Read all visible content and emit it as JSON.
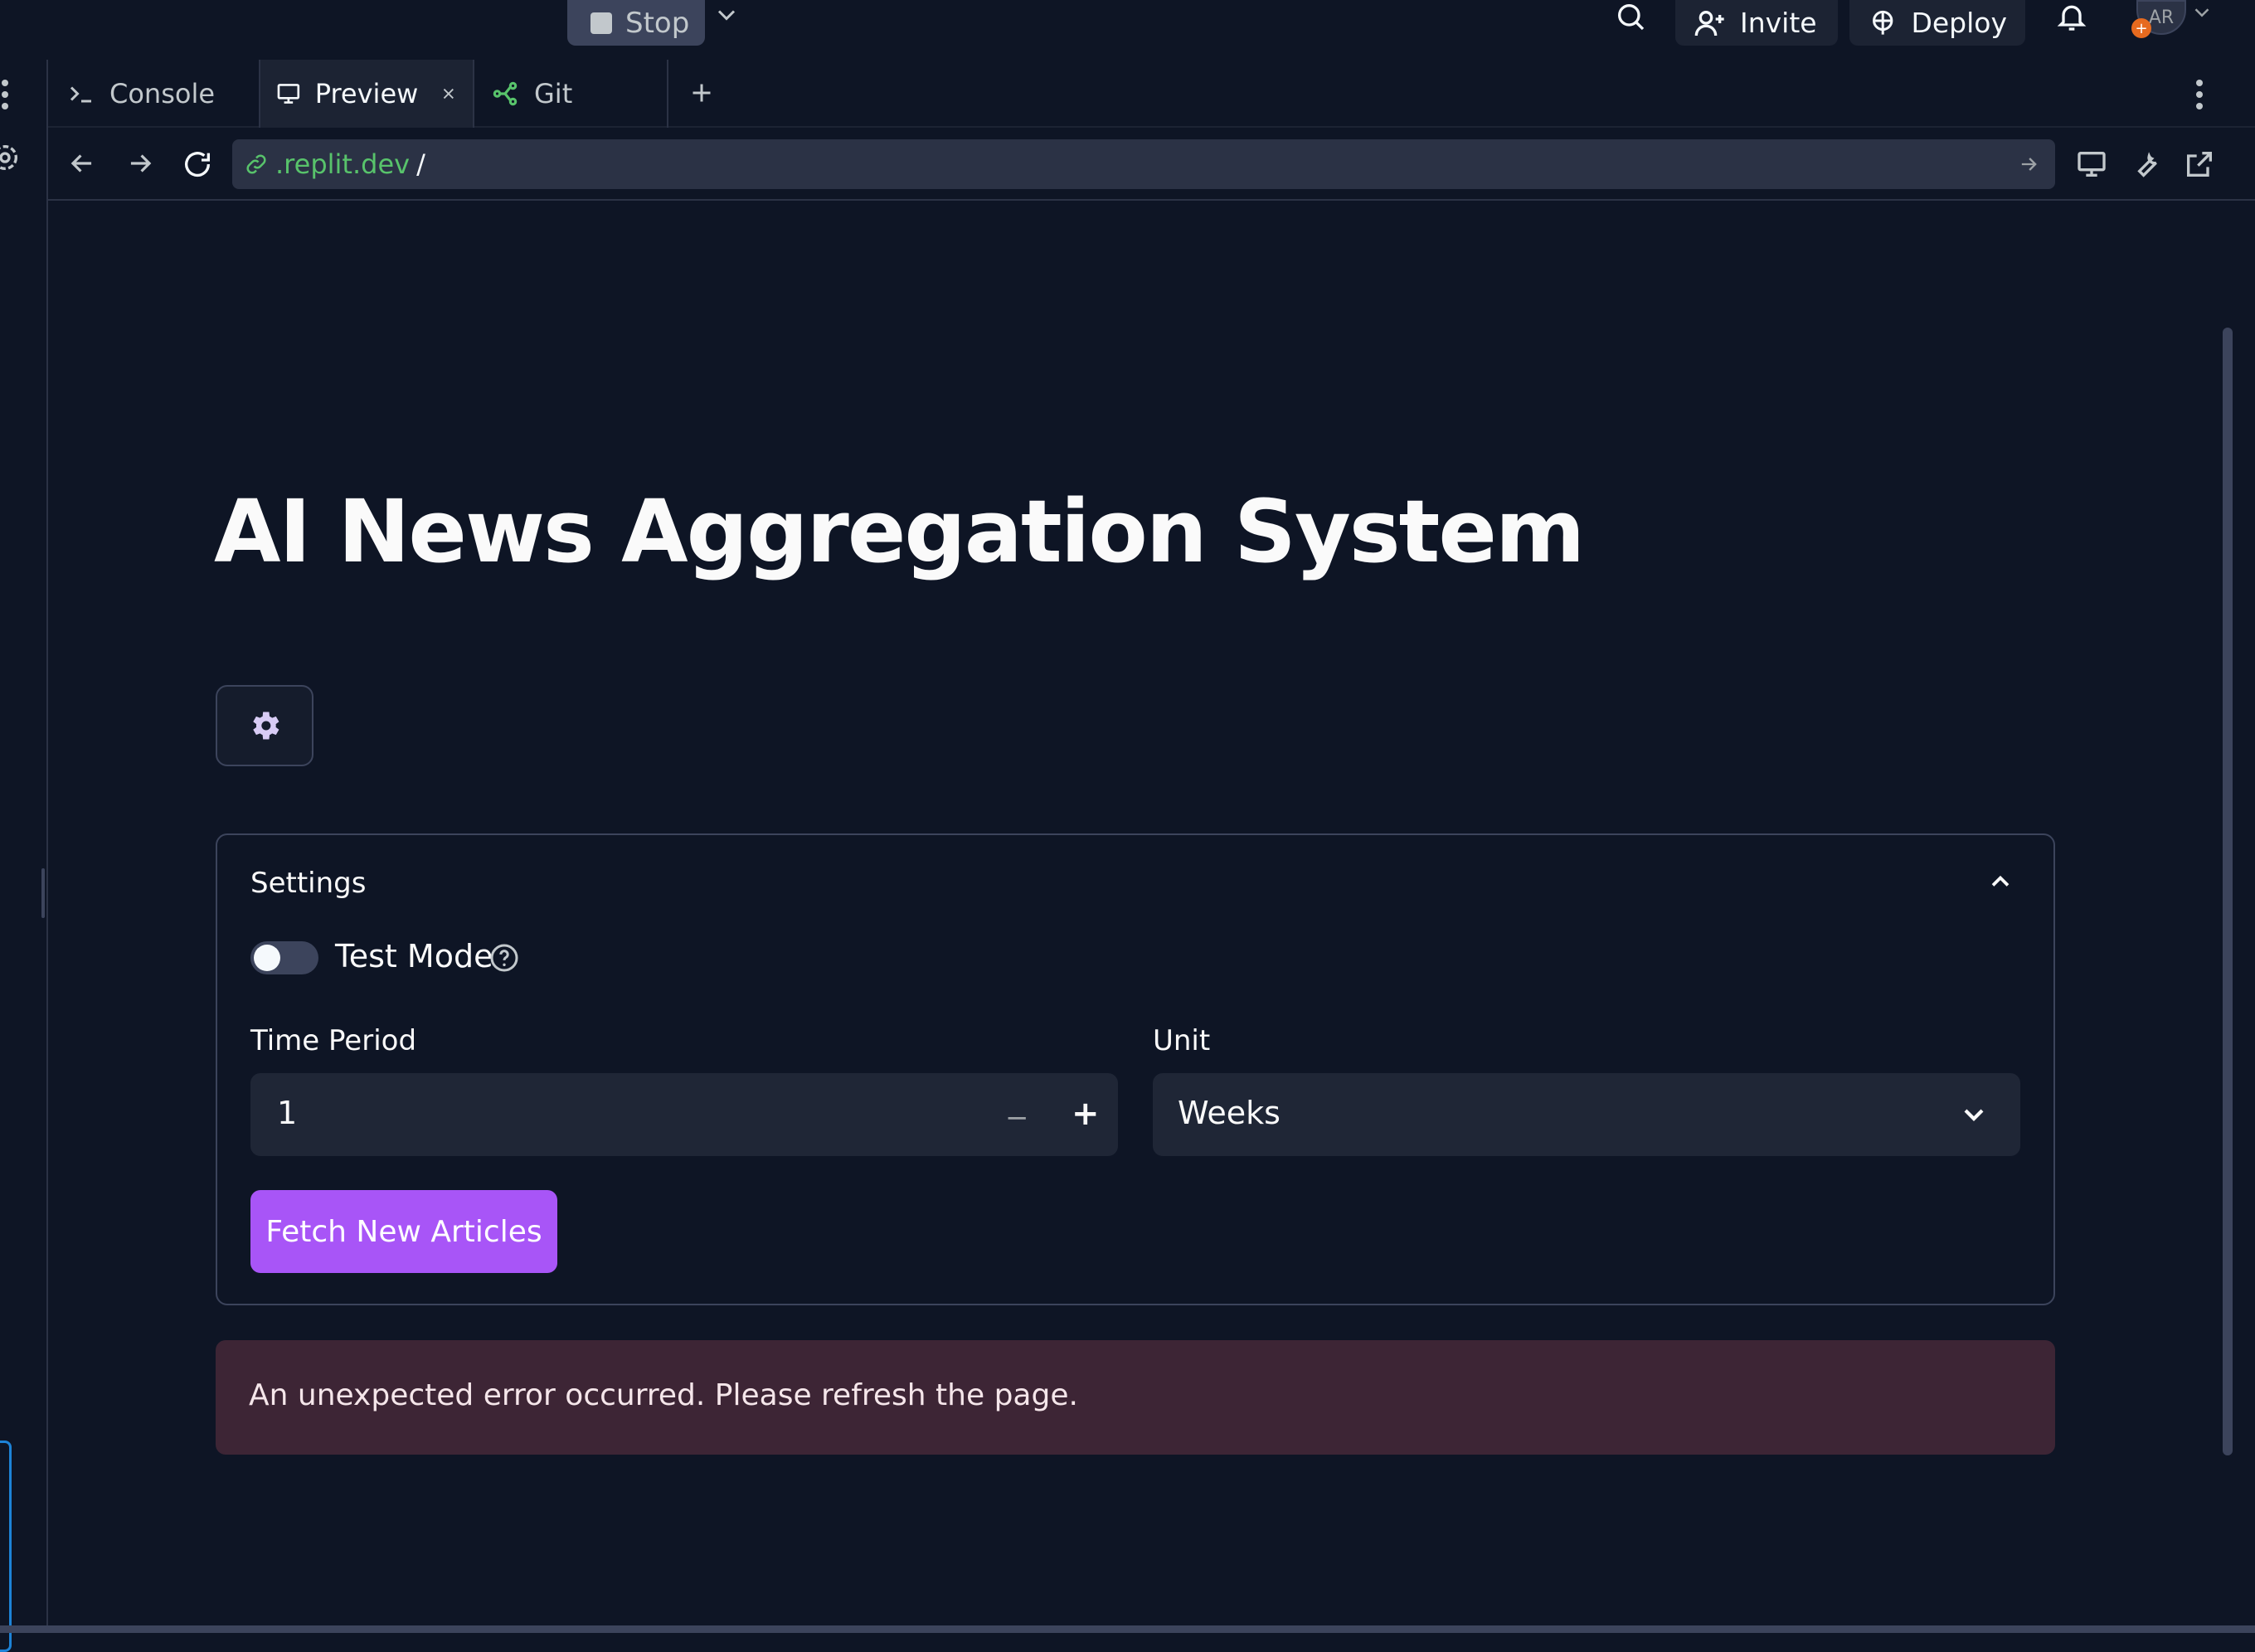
{
  "topbar": {
    "run_label": "Stop",
    "invite_label": "Invite",
    "deploy_label": "Deploy",
    "avatar_initials": "AR"
  },
  "tabs": [
    {
      "label": "Console",
      "icon": "terminal-icon"
    },
    {
      "label": "Preview",
      "icon": "monitor-icon",
      "active": true
    },
    {
      "label": "Git",
      "icon": "git-branch-icon"
    }
  ],
  "addressbar": {
    "host": ".replit.dev",
    "path": "/"
  },
  "app": {
    "title": "AI News Aggregation System",
    "settings": {
      "header": "Settings",
      "test_mode_label": "Test Mode",
      "test_mode_on": false,
      "time_period_label": "Time Period",
      "time_period_value": "1",
      "unit_label": "Unit",
      "unit_value": "Weeks",
      "fetch_button": "Fetch New Articles"
    },
    "error_message": "An unexpected error occurred. Please refresh the page."
  },
  "colors": {
    "background": "#0e1525",
    "accent": "#a855f7",
    "error_bg": "#3d2535",
    "link_green": "#58c36b"
  }
}
